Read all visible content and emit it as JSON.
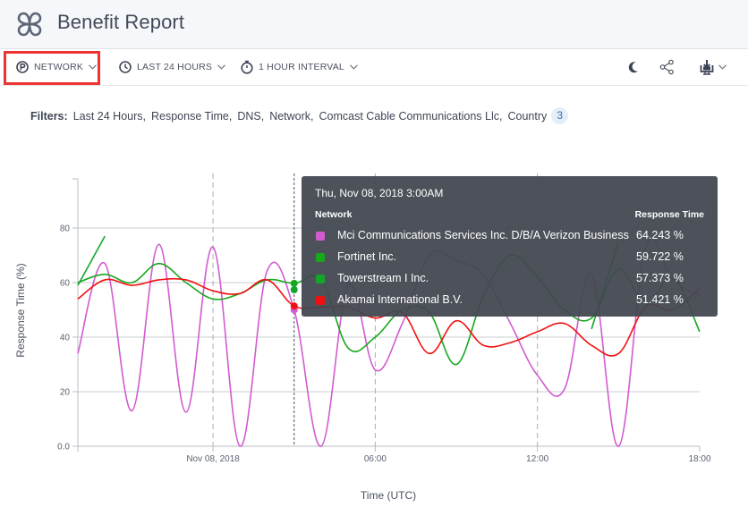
{
  "header": {
    "title": "Benefit Report",
    "logo_icon": "clover-logo-icon"
  },
  "toolbar": {
    "network_label": "NETWORK",
    "network_icon": "p-circle-icon",
    "time_range_label": "LAST 24 HOURS",
    "time_range_icon": "clock-icon",
    "interval_label": "1 HOUR INTERVAL",
    "interval_icon": "stopwatch-icon",
    "right_icons": [
      "moon-icon",
      "share-icon",
      "download-icon"
    ],
    "highlight_color": "#ee3333"
  },
  "filters": {
    "label": "Filters:",
    "items": [
      "Last 24 Hours,",
      "Response Time,",
      "DNS,",
      "Network,",
      "Comcast Cable Communications Llc,",
      "Country"
    ],
    "more_count": "3"
  },
  "tooltip": {
    "date": "Thu, Nov 08, 2018 3:00AM",
    "col_network": "Network",
    "col_value": "Response Time",
    "rows": [
      {
        "name": "Mci Communications Services Inc. D/B/A Verizon Business",
        "value": "64.243 %",
        "color": "#d25bd0"
      },
      {
        "name": "Fortinet Inc.",
        "value": "59.722 %",
        "color": "#18a81e"
      },
      {
        "name": "Towerstream I Inc.",
        "value": "57.373 %",
        "color": "#14a52a"
      },
      {
        "name": "Akamai International B.V.",
        "value": "51.421 %",
        "color": "#f01010"
      }
    ]
  },
  "chart_data": {
    "type": "line",
    "title": "",
    "xlabel": "Time (UTC)",
    "ylabel": "Response Time (%)",
    "ylim": [
      0,
      100
    ],
    "yticks": [
      "0.0",
      "20",
      "40",
      "60",
      "80"
    ],
    "ytick_values": [
      0,
      20,
      40,
      60,
      80
    ],
    "x_start_hour": -5,
    "x_end_hour": 18,
    "xticks": [
      {
        "hour": 0,
        "label": "Nov 08, 2018"
      },
      {
        "hour": 6,
        "label": "06:00"
      },
      {
        "hour": 12,
        "label": "12:00"
      },
      {
        "hour": 18,
        "label": "18:00"
      }
    ],
    "crosshair_hour": 3,
    "grid": true,
    "x_hours": [
      -5,
      -4,
      -3,
      -2,
      -1,
      0,
      1,
      2,
      3,
      4,
      5,
      6,
      7,
      8,
      9,
      10,
      11,
      12,
      13,
      14,
      15,
      16,
      17,
      18
    ],
    "series": [
      {
        "name": "Mci Communications Services Inc. D/B/A Verizon Business",
        "color": "#d25bd0",
        "values": [
          34,
          67,
          13,
          74,
          12.5,
          73,
          0,
          64.243,
          50,
          0,
          59,
          28,
          45,
          70,
          68,
          63,
          45,
          26,
          21,
          63,
          0,
          73,
          61,
          55
        ]
      },
      {
        "name": "Fortinet Inc.",
        "color": "#18a81e",
        "values": [
          60,
          63,
          60,
          67,
          60,
          54,
          56,
          61,
          59.722,
          61,
          36,
          40,
          50,
          49,
          30,
          55,
          70,
          62,
          50,
          47,
          65,
          52,
          62,
          42
        ]
      },
      {
        "name": "Towerstream I Inc.",
        "color": "#14a52a",
        "values": [
          59,
          77,
          null,
          null,
          null,
          null,
          null,
          null,
          57.373,
          null,
          null,
          null,
          null,
          null,
          null,
          null,
          null,
          null,
          null,
          43,
          75,
          null,
          null,
          null
        ]
      },
      {
        "name": "Akamai International B.V.",
        "color": "#f01010",
        "values": [
          54,
          61,
          59,
          61,
          61,
          57,
          56,
          61,
          51.421,
          51,
          51,
          47,
          49,
          34,
          46,
          37,
          38,
          42,
          45,
          37,
          34,
          51,
          50,
          58
        ]
      }
    ]
  }
}
